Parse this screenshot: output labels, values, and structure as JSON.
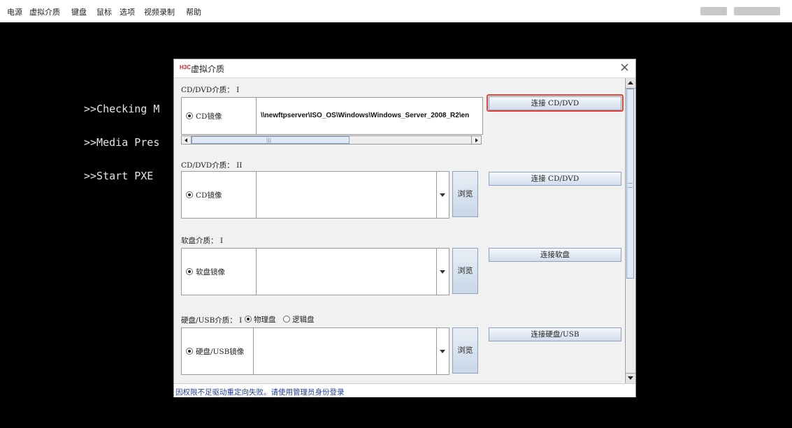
{
  "menubar": {
    "items": [
      "电源",
      "虚拟介质",
      "键盘",
      "鼠标",
      "选项",
      "视频录制",
      "帮助"
    ]
  },
  "console": {
    "lines": [
      ">>Checking M",
      ">>Media Pres",
      ">>Start PXE"
    ]
  },
  "dialog": {
    "logo": "H3C",
    "title": "虚拟介质",
    "close_glyph": "×",
    "cd1": {
      "section_label": "CD/DVD介质： I",
      "radio_label": "CD镜像",
      "path_value": "\\\\newftpserver\\ISO_OS\\Windows\\Windows_Server_2008_R2\\en",
      "scroll_grip": "|||",
      "connect_button": "连接 CD/DVD"
    },
    "cd2": {
      "section_label": "CD/DVD介质： II",
      "radio_label": "CD镜像",
      "browse_button": "浏览",
      "connect_button": "连接 CD/DVD"
    },
    "floppy": {
      "section_label": "软盘介质： I",
      "radio_label": "软盘镜像",
      "browse_button": "浏览",
      "connect_button": "连接软盘"
    },
    "usb": {
      "section_label": "硬盘/USB介质： I",
      "physical_label": "物理盘",
      "logical_label": "逻辑盘",
      "radio_label": "硬盘/USB镜像",
      "browse_button": "浏览",
      "connect_button": "连接硬盘/USB"
    },
    "status_text": "因权限不足驱动重定向失败。请使用管理员身份登录"
  },
  "colors": {
    "highlight": "#e0443a",
    "status_text": "#1f3f9a",
    "logo": "#d2232a"
  }
}
